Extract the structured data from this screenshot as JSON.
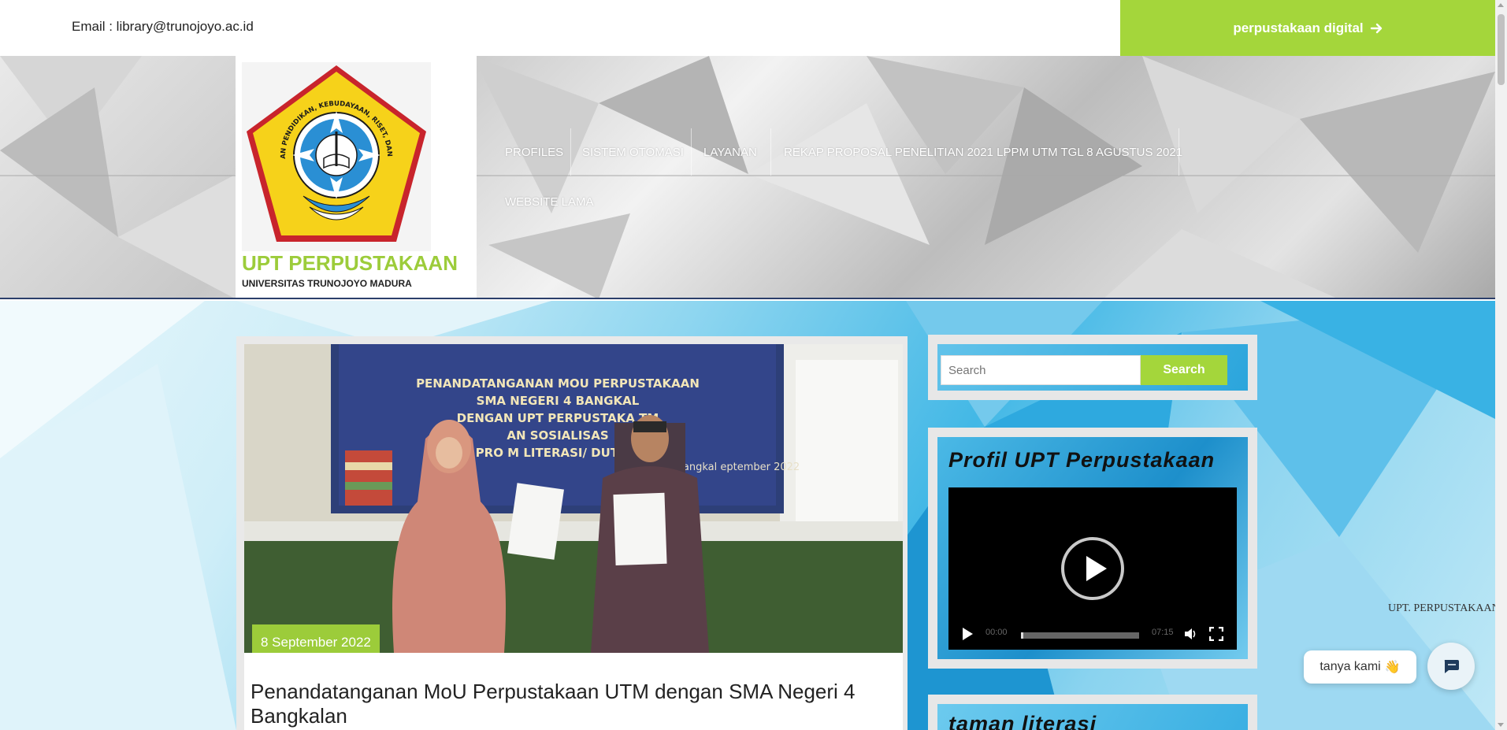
{
  "topbar": {
    "email": "Email : library@trunojoyo.ac.id",
    "digital_label": "perpustakaan digital"
  },
  "brand": {
    "title": "UPT PERPUSTAKAAN",
    "subtitle": "UNIVERSITAS TRUNOJOYO MADURA",
    "logo_ring_text": "KEMENTERIAN PENDIDIKAN, KEBUDAYAAN, RISET, DAN TEKNOLOGI",
    "logo_name_text": "UNIVERSITAS TRUNOJOYO MADURA"
  },
  "nav": {
    "items": [
      {
        "label": "PROFILES"
      },
      {
        "label": "SISTEM OTOMASI"
      },
      {
        "label": "LAYANAN"
      },
      {
        "label": "REKAP PROPOSAL PENELITIAN 2021 LPPM UTM TGL 8 AGUSTUS 2021"
      },
      {
        "label": "WEBSITE LAMA"
      }
    ]
  },
  "ticker": {
    "text": "UPT. PERPUSTAKAAN"
  },
  "post": {
    "date": "8 September 2022",
    "title": "Penandatanganan MoU Perpustakaan UTM dengan SMA Negeri 4 Bangkalan",
    "banner_lines": [
      "PENANDATANGANAN MOU PERPUSTAKAAN",
      "SMA NEGERI 4 BANGKAL",
      "DENGAN UPT PERPUSTAKA     TM",
      "AN SOSIALISAS",
      "PRO     M LITERASI/ DUTA    A"
    ],
    "banner_place": "Bangkal       eptember 2022"
  },
  "search": {
    "placeholder": "Search",
    "button_label": "Search"
  },
  "profile_widget": {
    "title": "Profil UPT Perpustakaan",
    "video": {
      "current_time": "00:00",
      "duration": "07:15"
    }
  },
  "literasi_widget": {
    "title": "taman literasi"
  },
  "chat": {
    "label": "tanya kami",
    "emoji": "👋"
  },
  "colors": {
    "accent": "#a4d63b",
    "brand_title": "#9ccc3a",
    "nav_text": "#ffffff"
  }
}
